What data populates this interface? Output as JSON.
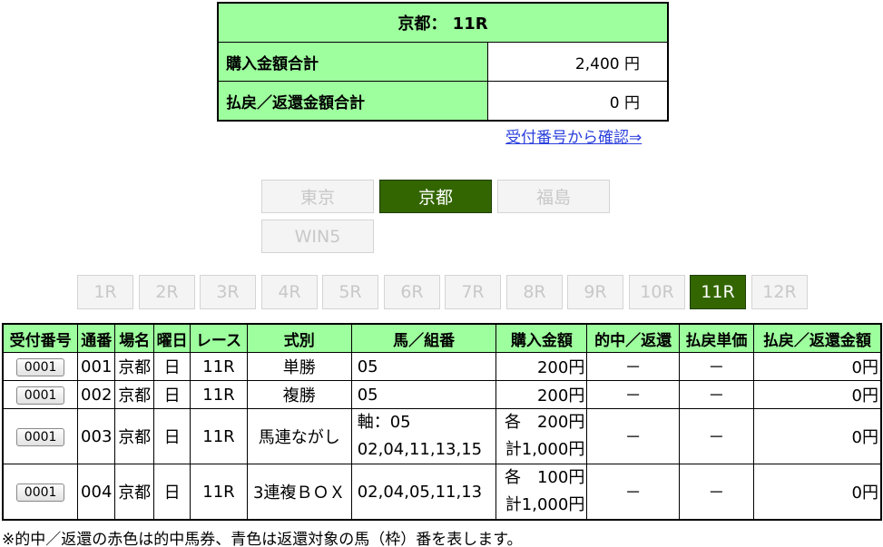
{
  "summary": {
    "title": "京都： 11R",
    "purchase_label": "購入金額合計",
    "purchase_value": "2,400 円",
    "payout_label": "払戻／返還金額合計",
    "payout_value": "0 円",
    "confirm_link": "受付番号から確認⇒"
  },
  "venues": [
    {
      "label": "東京",
      "active": false
    },
    {
      "label": "京都",
      "active": true
    },
    {
      "label": "福島",
      "active": false
    },
    {
      "label": "WIN5",
      "active": false
    }
  ],
  "races": [
    {
      "label": "1R",
      "active": false
    },
    {
      "label": "2R",
      "active": false
    },
    {
      "label": "3R",
      "active": false
    },
    {
      "label": "4R",
      "active": false
    },
    {
      "label": "5R",
      "active": false
    },
    {
      "label": "6R",
      "active": false
    },
    {
      "label": "7R",
      "active": false
    },
    {
      "label": "8R",
      "active": false
    },
    {
      "label": "9R",
      "active": false
    },
    {
      "label": "10R",
      "active": false
    },
    {
      "label": "11R",
      "active": true
    },
    {
      "label": "12R",
      "active": false
    }
  ],
  "table": {
    "headers": [
      "受付番号",
      "通番",
      "場名",
      "曜日",
      "レース",
      "式別",
      "馬／組番",
      "購入金額",
      "的中／返還",
      "払戻単価",
      "払戻／返還金額"
    ],
    "rows": [
      {
        "receipt": "0001",
        "serial": "001",
        "venue": "京都",
        "day": "日",
        "race": "11R",
        "type": "単勝",
        "horses": [
          "05"
        ],
        "amount": [
          "200円"
        ],
        "hit": "－",
        "unit": "－",
        "payout": "0円"
      },
      {
        "receipt": "0001",
        "serial": "002",
        "venue": "京都",
        "day": "日",
        "race": "11R",
        "type": "複勝",
        "horses": [
          "05"
        ],
        "amount": [
          "200円"
        ],
        "hit": "－",
        "unit": "－",
        "payout": "0円"
      },
      {
        "receipt": "0001",
        "serial": "003",
        "venue": "京都",
        "day": "日",
        "race": "11R",
        "type": "馬連ながし",
        "horses": [
          "軸：05",
          "02,04,11,13,15"
        ],
        "amount": [
          "各　200円",
          "計1,000円"
        ],
        "hit": "－",
        "unit": "－",
        "payout": "0円"
      },
      {
        "receipt": "0001",
        "serial": "004",
        "venue": "京都",
        "day": "日",
        "race": "11R",
        "type": "3連複ＢＯＸ",
        "horses": [
          "02,04,05,11,13"
        ],
        "amount": [
          "各　100円",
          "計1,000円"
        ],
        "hit": "－",
        "unit": "－",
        "payout": "0円"
      }
    ]
  },
  "footnote": "※的中／返還の赤色は的中馬券、青色は返還対象の馬（枠）番を表します。",
  "colors": {
    "header_bg": "#9eff9e",
    "active_button": "#336600",
    "link": "#2a3fdc"
  }
}
